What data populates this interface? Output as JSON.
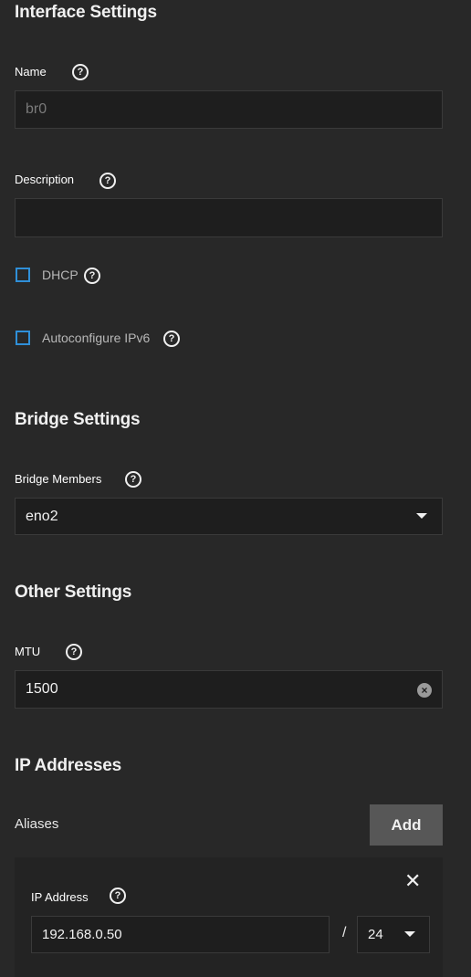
{
  "interface_settings": {
    "title": "Interface Settings",
    "name_label": "Name",
    "name_value": "br0",
    "description_label": "Description",
    "description_value": "",
    "dhcp_label": "DHCP",
    "autoconfig_label": "Autoconfigure IPv6"
  },
  "bridge_settings": {
    "title": "Bridge Settings",
    "members_label": "Bridge Members",
    "members_value": "eno2"
  },
  "other_settings": {
    "title": "Other Settings",
    "mtu_label": "MTU",
    "mtu_value": "1500"
  },
  "ip_addresses": {
    "title": "IP Addresses",
    "aliases_label": "Aliases",
    "add_label": "Add",
    "alias": {
      "ip_label": "IP Address",
      "ip_value": "192.168.0.50",
      "separator": "/",
      "netmask_value": "24"
    }
  },
  "icons": {
    "help": "?",
    "clear": "×",
    "close": "✕"
  },
  "colors": {
    "background": "#282828",
    "input_bg": "#1e1e1e",
    "checkbox_border": "#2f8fd8",
    "add_button_bg": "#575757"
  }
}
